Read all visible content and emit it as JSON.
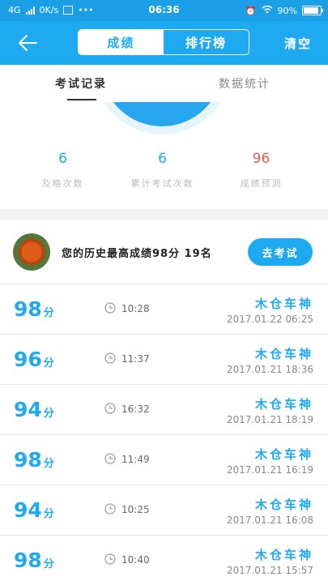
{
  "status_bar": {
    "network": "4G",
    "speed": "0K/s",
    "dots": "•••",
    "time": "06:36",
    "battery": "90%"
  },
  "header": {
    "tab_scores": "成绩",
    "tab_ranking": "排行榜",
    "clear_label": "清空",
    "accent_color": "#1eaaf1"
  },
  "subtabs": {
    "records": "考试记录",
    "statistics": "数据统计"
  },
  "stats": [
    {
      "value": "6",
      "label": "及格次数",
      "color": "#1eaaf1"
    },
    {
      "value": "6",
      "label": "累计考试次数",
      "color": "#1eaaf1"
    },
    {
      "value": "96",
      "label": "成绩预测",
      "color": "#e85a4f"
    }
  ],
  "best": {
    "text": "您的历史最高成绩98分  19名",
    "button": "去考试"
  },
  "records": [
    {
      "score": "98",
      "unit": "分",
      "duration": "10:28",
      "name": "木仓车神",
      "date": "2017.01.22  06:25"
    },
    {
      "score": "96",
      "unit": "分",
      "duration": "11:37",
      "name": "木仓车神",
      "date": "2017.01.21  18:36"
    },
    {
      "score": "94",
      "unit": "分",
      "duration": "16:32",
      "name": "木仓车神",
      "date": "2017.01.21  18:19"
    },
    {
      "score": "98",
      "unit": "分",
      "duration": "11:49",
      "name": "木仓车神",
      "date": "2017.01.21  16:19"
    },
    {
      "score": "94",
      "unit": "分",
      "duration": "10:25",
      "name": "木仓车神",
      "date": "2017.01.21  16:08"
    },
    {
      "score": "98",
      "unit": "分",
      "duration": "10:40",
      "name": "木仓车神",
      "date": "2017.01.21  15:57"
    }
  ]
}
